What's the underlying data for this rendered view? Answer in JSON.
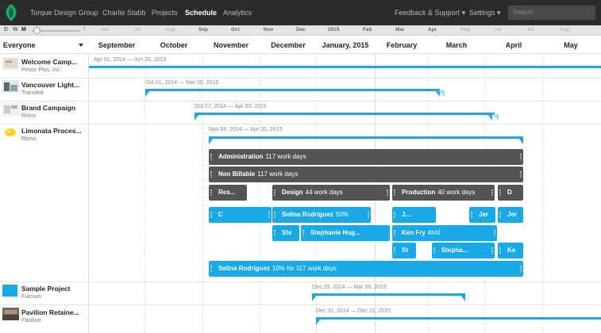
{
  "nav": {
    "items": [
      "Torque Design Group",
      "Charlie Stabb",
      "Projects",
      "Schedule",
      "Analytics"
    ],
    "feedback": "Feedback & Support",
    "settings": "Settings",
    "search_placeholder": "Search",
    "accent": "#18a9e6"
  },
  "zoom": {
    "letters": [
      "D",
      "W",
      "M"
    ],
    "end_letter": "T"
  },
  "strip_labels": [
    "Jun",
    "Jul",
    "Aug",
    "Sep",
    "Oct",
    "Nov",
    "Dec",
    "2015",
    "Feb",
    "Mar",
    "Apr",
    "May",
    "Jun",
    "Jul",
    "Aug"
  ],
  "header": {
    "everyone": "Everyone",
    "months": [
      "September",
      "October",
      "November",
      "December",
      "January, 2015",
      "February",
      "March",
      "April",
      "May"
    ]
  },
  "projects": [
    {
      "name": "Welcome Camp...",
      "client": "Pinion Plus, Inc.",
      "dates": "Apr 01, 2014 — Jun 25, 2015"
    },
    {
      "name": "Vancouver Light...",
      "client": "Translink",
      "dates": "Oct 01, 2014 — Mar 06, 2015"
    },
    {
      "name": "Brand Campaign",
      "client": "Ritmo",
      "dates": "Oct 27, 2014 — Apr 03, 2015"
    },
    {
      "name": "Limonata Proces...",
      "client": "Ritmo",
      "dates": "Nov 04, 2014 — Apr 20, 2015"
    },
    {
      "name": "Sample Project",
      "client": "Fulcrum",
      "dates": "Dec 29, 2014 — Mar 20, 2015"
    },
    {
      "name": "Pavilion Retaine...",
      "client": "Pavilion",
      "dates": "Dec 31, 2014 — Dec 31, 2015"
    }
  ],
  "tasks": {
    "administration": {
      "label": "Administration",
      "detail": "117 work days"
    },
    "non_billable": {
      "label": "Non Billable",
      "detail": "117 work days"
    },
    "research": {
      "label": "Res..."
    },
    "design": {
      "label": "Design",
      "detail": "44 work days"
    },
    "production": {
      "label": "Production",
      "detail": "40 work days"
    },
    "d": {
      "label": "D"
    },
    "c": {
      "label": "C"
    },
    "selina": {
      "label": "Selina Rodriguez",
      "detail": "50%"
    },
    "j1": {
      "label": "J..."
    },
    "jer": {
      "label": "Jer"
    },
    "jer2": {
      "label": "Jer"
    },
    "ste": {
      "label": "Ste"
    },
    "stephanie": {
      "label": "Stephanie Hug..."
    },
    "kenfry": {
      "label": "Ken Fry",
      "detail": "4h/d"
    },
    "st": {
      "label": "St"
    },
    "stepha": {
      "label": "Stepha..."
    },
    "ke": {
      "label": "Ke"
    },
    "selina_full": {
      "label": "Selina Rodriguez",
      "detail": "10% for 117 work days"
    }
  }
}
